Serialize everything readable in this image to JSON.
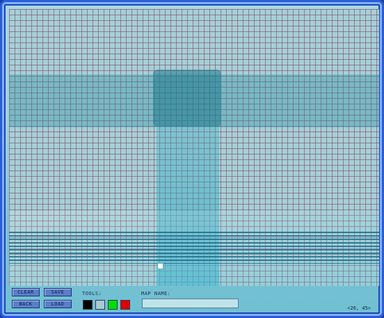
{
  "toolbar": {
    "clear_label": "CLEAR",
    "save_label": "SAVE",
    "back_label": "BACK",
    "load_label": "LOAD"
  },
  "tools": {
    "label": "TOOLS:",
    "swatches": [
      {
        "name": "black-tile",
        "color": "#000000"
      },
      {
        "name": "floor-tile",
        "color": "#a9c9d4"
      },
      {
        "name": "green-tile",
        "color": "#00e000"
      },
      {
        "name": "red-tile",
        "color": "#e00000"
      }
    ]
  },
  "map_name": {
    "label": "MAP NAME:",
    "value": ""
  },
  "status": {
    "coords": "<26, 45>"
  },
  "colors": {
    "frame_border": "#2a5cd8",
    "grid_line": "#7a3c5a",
    "button_fill": "#5a7fc8"
  }
}
